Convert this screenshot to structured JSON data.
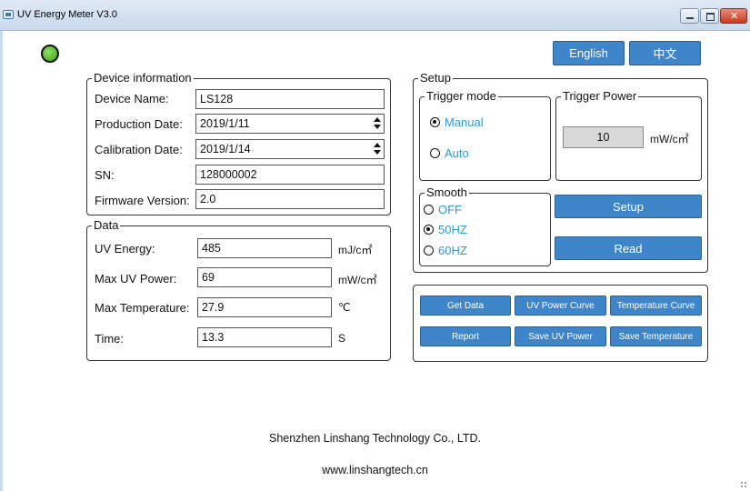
{
  "window": {
    "title": "UV Energy Meter V3.0"
  },
  "language": {
    "english": "English",
    "chinese": "中文"
  },
  "device_info": {
    "legend": "Device information",
    "device_name_label": "Device Name:",
    "device_name": "LS128",
    "production_date_label": "Production Date:",
    "production_date": "2019/1/11",
    "calibration_date_label": "Calibration Date:",
    "calibration_date": "2019/1/14",
    "sn_label": "SN:",
    "sn": "128000002",
    "firmware_label": "Firmware Version:",
    "firmware": "2.0"
  },
  "data": {
    "legend": "Data",
    "uv_energy_label": "UV Energy:",
    "uv_energy": "485",
    "uv_energy_unit": "mJ/c㎡",
    "max_uv_power_label": "Max UV Power:",
    "max_uv_power": "69",
    "max_uv_power_unit": "mW/c㎡",
    "max_temp_label": "Max Temperature:",
    "max_temp": "27.9",
    "max_temp_unit": "℃",
    "time_label": "Time:",
    "time": "13.3",
    "time_unit": "S"
  },
  "setup": {
    "legend": "Setup",
    "trigger_mode": {
      "legend": "Trigger mode",
      "options": [
        {
          "label": "Manual",
          "selected": true
        },
        {
          "label": "Auto",
          "selected": false
        }
      ]
    },
    "trigger_power": {
      "legend": "Trigger Power",
      "value": "10",
      "unit": "mW/c㎡"
    },
    "smooth": {
      "legend": "Smooth",
      "options": [
        {
          "label": "OFF",
          "selected": false
        },
        {
          "label": "50HZ",
          "selected": true
        },
        {
          "label": "60HZ",
          "selected": false
        }
      ]
    },
    "setup_button": "Setup",
    "read_button": "Read"
  },
  "actions": {
    "get_data": "Get Data",
    "uv_power_curve": "UV Power Curve",
    "temperature_curve": "Temperature Curve",
    "report": "Report",
    "save_uv_power": "Save UV Power",
    "save_temperature": "Save Temperature"
  },
  "footer": {
    "company": "Shenzhen Linshang Technology Co., LTD.",
    "website": "www.linshangtech.cn"
  },
  "colors": {
    "button": "#3e86c9",
    "radio_text": "#2b9bd8",
    "led": "#4caf1f"
  }
}
